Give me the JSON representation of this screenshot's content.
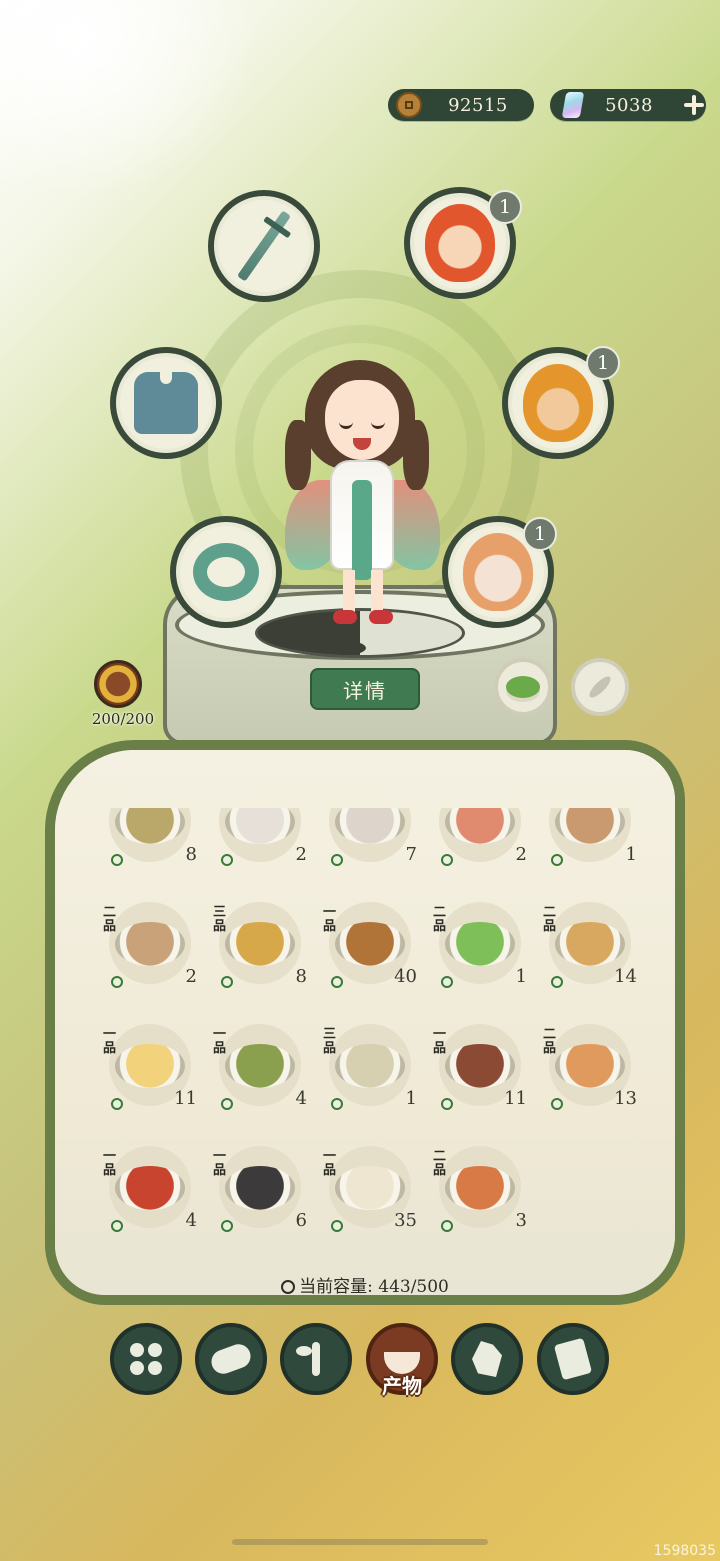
{
  "currency": {
    "coins": "92515",
    "gems": "5038"
  },
  "equipment": {
    "weapon": {
      "icon": "sword-icon"
    },
    "armor": {
      "icon": "armor-icon"
    },
    "accessory": {
      "icon": "jade-ring-icon"
    },
    "companion_1": {
      "icon": "fire-hero-portrait",
      "badge": "1"
    },
    "companion_2": {
      "icon": "monkey-king-portrait",
      "badge": "1"
    },
    "companion_3": {
      "icon": "sage-portrait",
      "badge": "1"
    }
  },
  "stamina": {
    "text": "200/200"
  },
  "detail_button": {
    "label": "详情"
  },
  "inventory": {
    "items": [
      {
        "grade": "",
        "count": "8",
        "food": "#b9a86a"
      },
      {
        "grade": "",
        "count": "2",
        "food": "#e6e0d8"
      },
      {
        "grade": "",
        "count": "7",
        "food": "#ddd4cc"
      },
      {
        "grade": "",
        "count": "2",
        "food": "#e08a70"
      },
      {
        "grade": "",
        "count": "1",
        "food": "#c99a70"
      },
      {
        "grade": "二品",
        "count": "2",
        "food": "#c9a27a"
      },
      {
        "grade": "三品",
        "count": "8",
        "food": "#d7a84a"
      },
      {
        "grade": "一品",
        "count": "40",
        "food": "#b07438"
      },
      {
        "grade": "二品",
        "count": "1",
        "food": "#7fbf5a"
      },
      {
        "grade": "二品",
        "count": "14",
        "food": "#d9a860"
      },
      {
        "grade": "一品",
        "count": "11",
        "food": "#f2d27a"
      },
      {
        "grade": "一品",
        "count": "4",
        "food": "#8aa04e"
      },
      {
        "grade": "三品",
        "count": "1",
        "food": "#d6d0b0"
      },
      {
        "grade": "一品",
        "count": "11",
        "food": "#8a4a34"
      },
      {
        "grade": "二品",
        "count": "13",
        "food": "#e09a5e"
      },
      {
        "grade": "一品",
        "count": "4",
        "food": "#c8442e"
      },
      {
        "grade": "一品",
        "count": "6",
        "food": "#3c3a3a"
      },
      {
        "grade": "一品",
        "count": "35",
        "food": "#efe6d2"
      },
      {
        "grade": "二品",
        "count": "3",
        "food": "#d77a46"
      }
    ],
    "capacity_label": "当前容量:",
    "capacity_value": "443/500"
  },
  "tabs": [
    {
      "icon": "grid-icon",
      "label": ""
    },
    {
      "icon": "log-icon",
      "label": ""
    },
    {
      "icon": "sprout-icon",
      "label": ""
    },
    {
      "icon": "bowl-icon",
      "label": "产物",
      "active": true
    },
    {
      "icon": "map-icon",
      "label": ""
    },
    {
      "icon": "scroll-icon",
      "label": ""
    }
  ],
  "watermark": "1598035"
}
